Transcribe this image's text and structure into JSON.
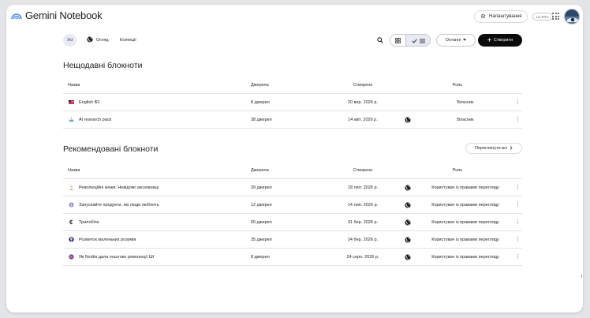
{
  "app": {
    "title": "Gemini Notebook"
  },
  "header": {
    "settings_label": "Налаштування",
    "plan_badge": "ULTRA",
    "apps_icon": "apps-grid-icon",
    "avatar_icon": "user-avatar"
  },
  "toolbar": {
    "tabs": [
      {
        "label": "Усі",
        "selected": true
      },
      {
        "label": "Огляд",
        "icon": "globe-icon"
      },
      {
        "label": "Колекції"
      }
    ],
    "sort_label": "Останні",
    "create_label": "Створити"
  },
  "recent": {
    "title": "Нещодавні блокноти",
    "columns": {
      "name": "Назва",
      "sources": "Джерела",
      "created": "Створено",
      "role": "Роль"
    },
    "rows": [
      {
        "icon": "flag-icon",
        "name": "English B2",
        "sources": "8 джерел",
        "created": "20 вер. 2026 р.",
        "public": false,
        "role": "Власник"
      },
      {
        "icon": "cake-icon",
        "name": "AI research pack",
        "sources": "38 джерел",
        "created": "14 квіт. 2026 р.",
        "public": true,
        "role": "Власник"
      }
    ]
  },
  "featured": {
    "title": "Рекомендовані блокноти",
    "view_all_label": "Переглянути всі",
    "columns": {
      "name": "Назва",
      "sources": "Джерела",
      "created": "Створено",
      "role": "Роль"
    },
    "rows": [
      {
        "icon": "woman-icon",
        "name": "Революційні жінки: Невідомі засновниці",
        "sources": "39 джерел",
        "created": "18 лют. 2026 р.",
        "public": true,
        "role": "Користувач із правами перегляду"
      },
      {
        "icon": "brain-icon",
        "name": "Запускайте продукти, які люди люблять",
        "sources": "12 джерел",
        "created": "14 лип. 2026 р.",
        "public": true,
        "role": "Користувач із правами перегляду"
      },
      {
        "icon": "coin-icon",
        "name": "Трилобіти",
        "sources": "65 джерел",
        "created": "31 бер. 2026 р.",
        "public": true,
        "role": "Користувач із правами перегляду"
      },
      {
        "icon": "baby-icon",
        "name": "Розвиток маленьких розумів",
        "sources": "35 джерел",
        "created": "24 бер. 2026 р.",
        "public": true,
        "role": "Користувач із правами перегляду"
      },
      {
        "icon": "chip-icon",
        "name": "Як Nvidia дала поштовх революції ШІ",
        "sources": "8 джерел",
        "created": "24 серп. 2026 р.",
        "public": true,
        "role": "Користувач із правами перегляду"
      }
    ]
  },
  "colors": {
    "accent": "#0b0b0b",
    "selected_chip": "#e8eaf6",
    "brand": "#1a73e8"
  }
}
